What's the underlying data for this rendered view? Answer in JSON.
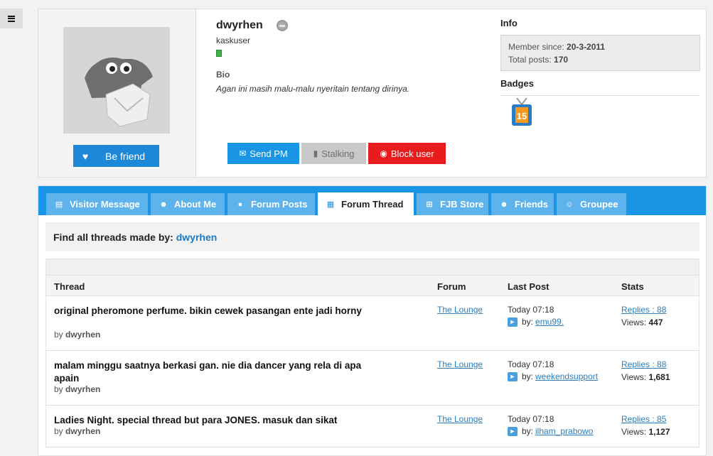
{
  "profile": {
    "username": "dwyrhen",
    "user_title": "kaskuser",
    "bio_label": "Bio",
    "bio_text": "Agan ini masih malu-malu nyeritain tentang dirinya.",
    "befriend_label": "Be friend",
    "send_pm_label": "Send PM",
    "stalking_label": "Stalking",
    "block_label": "Block user"
  },
  "info": {
    "heading": "Info",
    "member_since_label": "Member since:",
    "member_since_value": "20-3-2011",
    "total_posts_label": "Total posts:",
    "total_posts_value": "170",
    "badges_heading": "Badges"
  },
  "tabs": [
    {
      "label": "Visitor Message",
      "icon": "message-icon"
    },
    {
      "label": "About Me",
      "icon": "user-icon"
    },
    {
      "label": "Forum Posts",
      "icon": "speech-bubble-icon"
    },
    {
      "label": "Forum Thread",
      "icon": "calendar-icon",
      "active": true
    },
    {
      "label": "FJB Store",
      "icon": "cart-icon"
    },
    {
      "label": "Friends",
      "icon": "user-icon"
    },
    {
      "label": "Groupee",
      "icon": "group-icon"
    }
  ],
  "find": {
    "label": "Find all threads made by:",
    "user": "dwyrhen"
  },
  "table": {
    "headers": {
      "thread": "Thread",
      "forum": "Forum",
      "last_post": "Last Post",
      "stats": "Stats"
    },
    "by_label": "by",
    "lp_by_label": "by:",
    "views_label": "Views:",
    "rows": [
      {
        "title": "original pheromone perfume. bikin cewek pasangan ente jadi horny",
        "author": "dwyrhen",
        "forum": "The Lounge",
        "last_post_time": "Today 07:18",
        "last_post_by": "emu99.",
        "replies": "Replies : 88",
        "views": "447"
      },
      {
        "title": "malam minggu saatnya berkasi gan. nie dia dancer yang rela di apa apain",
        "author": "dwyrhen",
        "forum": "The Lounge",
        "last_post_time": "Today 07:18",
        "last_post_by": "weekendsupport",
        "replies": "Replies : 88",
        "views": "1,681"
      },
      {
        "title": "Ladies Night. special thread but para JONES. masuk dan sikat",
        "author": "dwyrhen",
        "forum": "The Lounge",
        "last_post_time": "Today 07:18",
        "last_post_by": "ilham_prabowo",
        "replies": "Replies : 85",
        "views": "1,127"
      }
    ]
  },
  "colors": {
    "accent_blue": "#1a95e6",
    "block_red": "#e81c1c",
    "link_blue": "#2b7dbd"
  }
}
